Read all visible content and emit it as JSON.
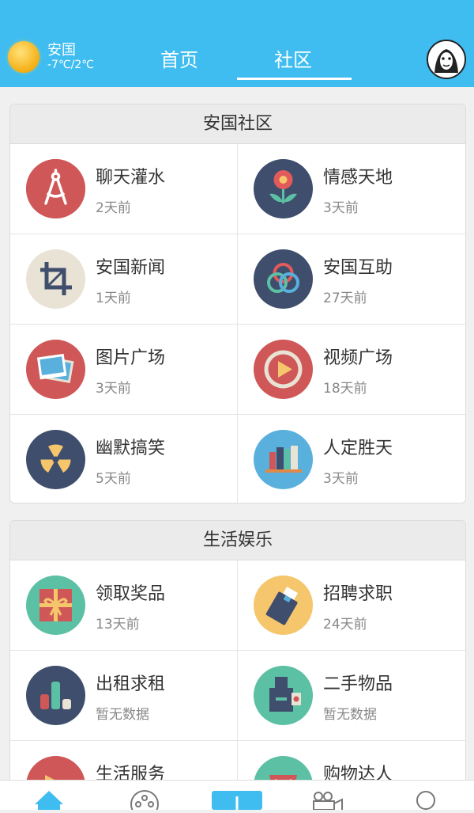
{
  "header": {
    "weather": {
      "city": "安国",
      "temp": "-7℃/2℃",
      "icon": "sun-icon"
    },
    "tabs": [
      {
        "label": "首页"
      },
      {
        "label": "社区",
        "active": true
      }
    ],
    "accent_color": "#3fbdf0"
  },
  "sections": [
    {
      "title": "安国社区",
      "items": [
        {
          "title": "聊天灌水",
          "subtitle": "2天前",
          "icon": "compass-icon",
          "color": "#cf5757"
        },
        {
          "title": "情感天地",
          "subtitle": "3天前",
          "icon": "flower-icon",
          "color": "#3f4e6c"
        },
        {
          "title": "安国新闻",
          "subtitle": "1天前",
          "icon": "crop-icon",
          "color": "#e8e3d4"
        },
        {
          "title": "安国互助",
          "subtitle": "27天前",
          "icon": "rings-icon",
          "color": "#3f4e6c"
        },
        {
          "title": "图片广场",
          "subtitle": "3天前",
          "icon": "photos-icon",
          "color": "#cf5757"
        },
        {
          "title": "视频广场",
          "subtitle": "18天前",
          "icon": "play-icon",
          "color": "#cf5757"
        },
        {
          "title": "幽默搞笑",
          "subtitle": "5天前",
          "icon": "radiation-icon",
          "color": "#3f4e6c"
        },
        {
          "title": "人定胜天",
          "subtitle": "3天前",
          "icon": "books-icon",
          "color": "#5ab0dd"
        }
      ]
    },
    {
      "title": "生活娱乐",
      "items": [
        {
          "title": "领取奖品",
          "subtitle": "13天前",
          "icon": "gift-icon",
          "color": "#5cc0a4"
        },
        {
          "title": "招聘求职",
          "subtitle": "24天前",
          "icon": "id-badge-icon",
          "color": "#f5c66c"
        },
        {
          "title": "出租求租",
          "subtitle": "暂无数据",
          "icon": "bar-chart-icon",
          "color": "#3f4e6c"
        },
        {
          "title": "二手物品",
          "subtitle": "暂无数据",
          "icon": "camera-icon",
          "color": "#5cc0a4"
        },
        {
          "title": "生活服务",
          "subtitle": "",
          "icon": "service-icon",
          "color": "#cf5757"
        },
        {
          "title": "购物达人",
          "subtitle": "",
          "icon": "shopping-icon",
          "color": "#5cc0a4"
        }
      ]
    }
  ],
  "bottom_nav": [
    {
      "icon": "home-icon"
    },
    {
      "icon": "film-reel-icon"
    },
    {
      "icon": "publish-icon"
    },
    {
      "icon": "video-camera-icon"
    },
    {
      "icon": "profile-icon"
    }
  ]
}
